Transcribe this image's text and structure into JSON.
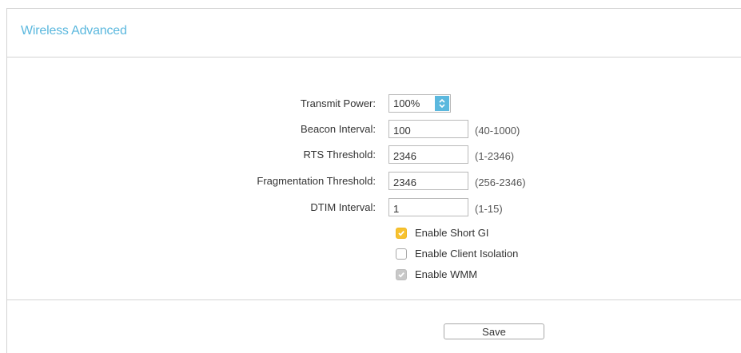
{
  "panel": {
    "title": "Wireless Advanced"
  },
  "form": {
    "transmit_power": {
      "label": "Transmit Power:",
      "value": "100%"
    },
    "beacon_interval": {
      "label": "Beacon Interval:",
      "value": "100",
      "hint": "(40-1000)"
    },
    "rts_threshold": {
      "label": "RTS Threshold:",
      "value": "2346",
      "hint": "(1-2346)"
    },
    "fragmentation_threshold": {
      "label": "Fragmentation Threshold:",
      "value": "2346",
      "hint": "(256-2346)"
    },
    "dtim_interval": {
      "label": "DTIM Interval:",
      "value": "1",
      "hint": "(1-15)"
    },
    "checkboxes": {
      "short_gi": {
        "label": "Enable Short GI",
        "checked": true,
        "disabled": false
      },
      "client_isolation": {
        "label": "Enable Client Isolation",
        "checked": false,
        "disabled": false
      },
      "wmm": {
        "label": "Enable WMM",
        "checked": true,
        "disabled": true
      }
    }
  },
  "actions": {
    "save_label": "Save"
  },
  "colors": {
    "accent": "#5bb8de",
    "checkbox_on": "#f7c230",
    "checkbox_disabled": "#c8c8c8",
    "border": "#d3d3d3"
  },
  "icons": {
    "select_arrow": "up-down-arrows-icon",
    "check": "checkmark-icon"
  }
}
